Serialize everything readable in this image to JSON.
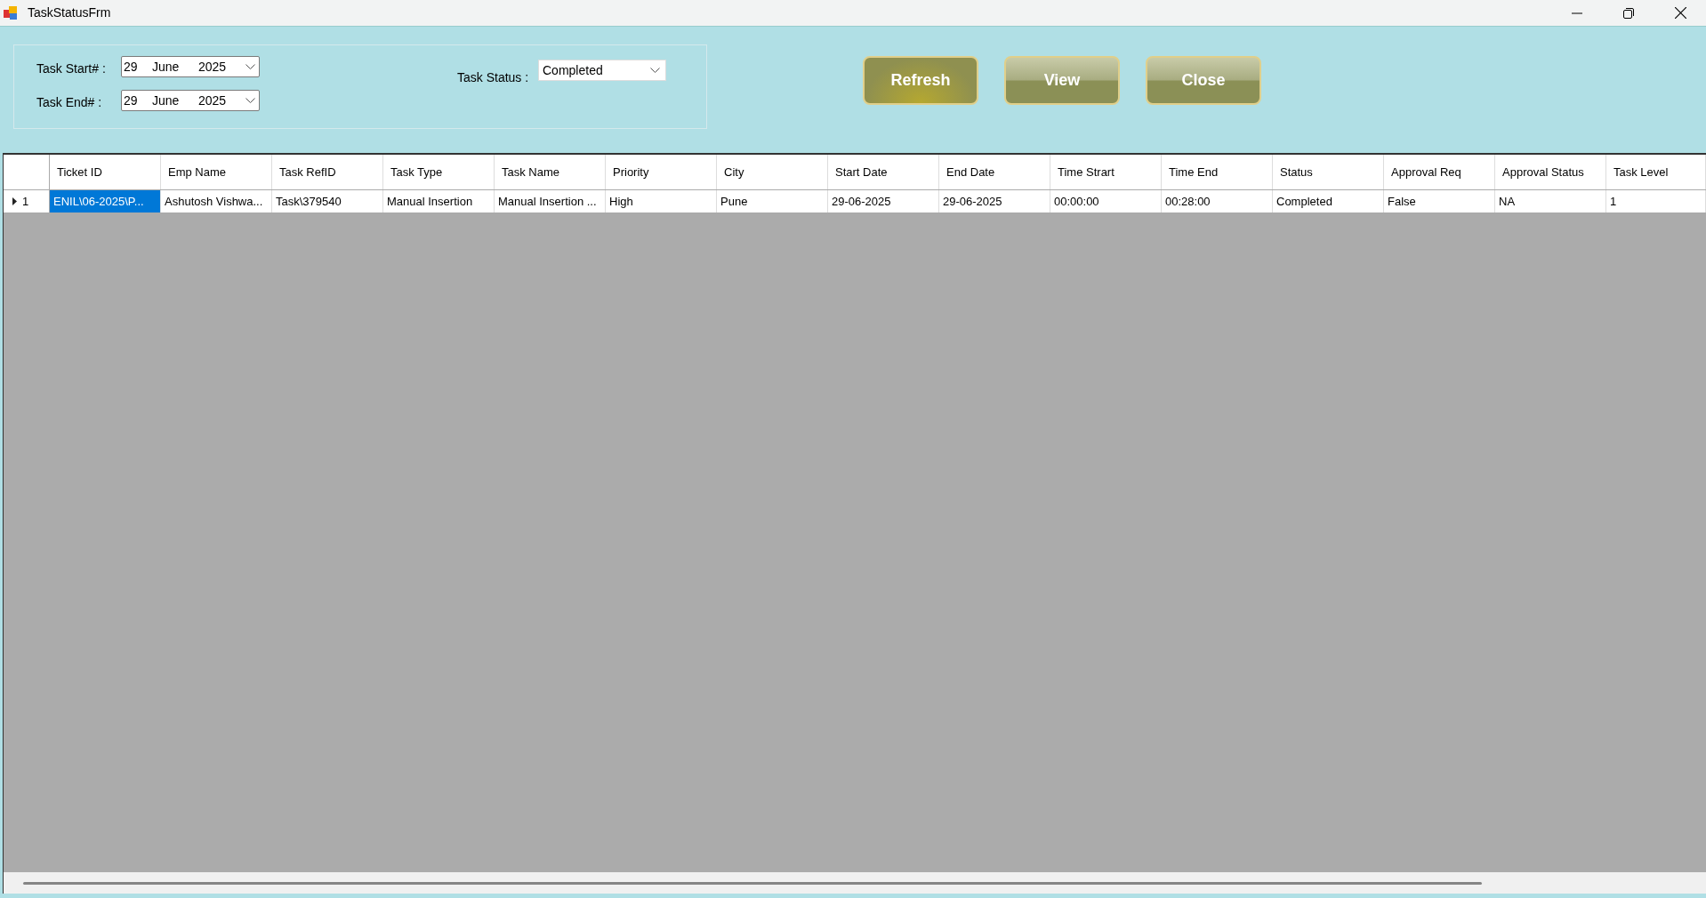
{
  "window": {
    "title": "TaskStatusFrm"
  },
  "filters": {
    "task_start": {
      "label": "Task Start# :",
      "day": "29",
      "month": "June",
      "year": "2025"
    },
    "task_end": {
      "label": "Task End# :",
      "day": "29",
      "month": "June",
      "year": "2025"
    },
    "task_status": {
      "label": "Task Status :",
      "value": "Completed"
    }
  },
  "buttons": [
    {
      "label": "Refresh",
      "hovered": true
    },
    {
      "label": "View",
      "hovered": false
    },
    {
      "label": "Close",
      "hovered": false
    }
  ],
  "table": {
    "columns": [
      "Ticket ID",
      "Emp Name",
      "Task RefID",
      "Task Type",
      "Task Name",
      "Priority",
      "City",
      "Start Date",
      "End Date",
      "Time Strart",
      "Time End",
      "Status",
      "Approval Req",
      "Approval Status",
      "Task Level"
    ],
    "rows": [
      {
        "row_header": "1",
        "current": true,
        "cells": [
          {
            "text": "ENIL\\06-2025\\P...",
            "selected": true
          },
          {
            "text": "Ashutosh Vishwa...",
            "selected": false
          },
          {
            "text": "Task\\379540",
            "selected": false
          },
          {
            "text": "Manual Insertion",
            "selected": false
          },
          {
            "text": "Manual Insertion ...",
            "selected": false
          },
          {
            "text": "High",
            "selected": false
          },
          {
            "text": "Pune",
            "selected": false
          },
          {
            "text": "29-06-2025",
            "selected": false
          },
          {
            "text": "29-06-2025",
            "selected": false
          },
          {
            "text": "00:00:00",
            "selected": false
          },
          {
            "text": "00:28:00",
            "selected": false
          },
          {
            "text": "Completed",
            "selected": false
          },
          {
            "text": "False",
            "selected": false
          },
          {
            "text": "NA",
            "selected": false
          },
          {
            "text": "1",
            "selected": false
          }
        ]
      }
    ]
  }
}
